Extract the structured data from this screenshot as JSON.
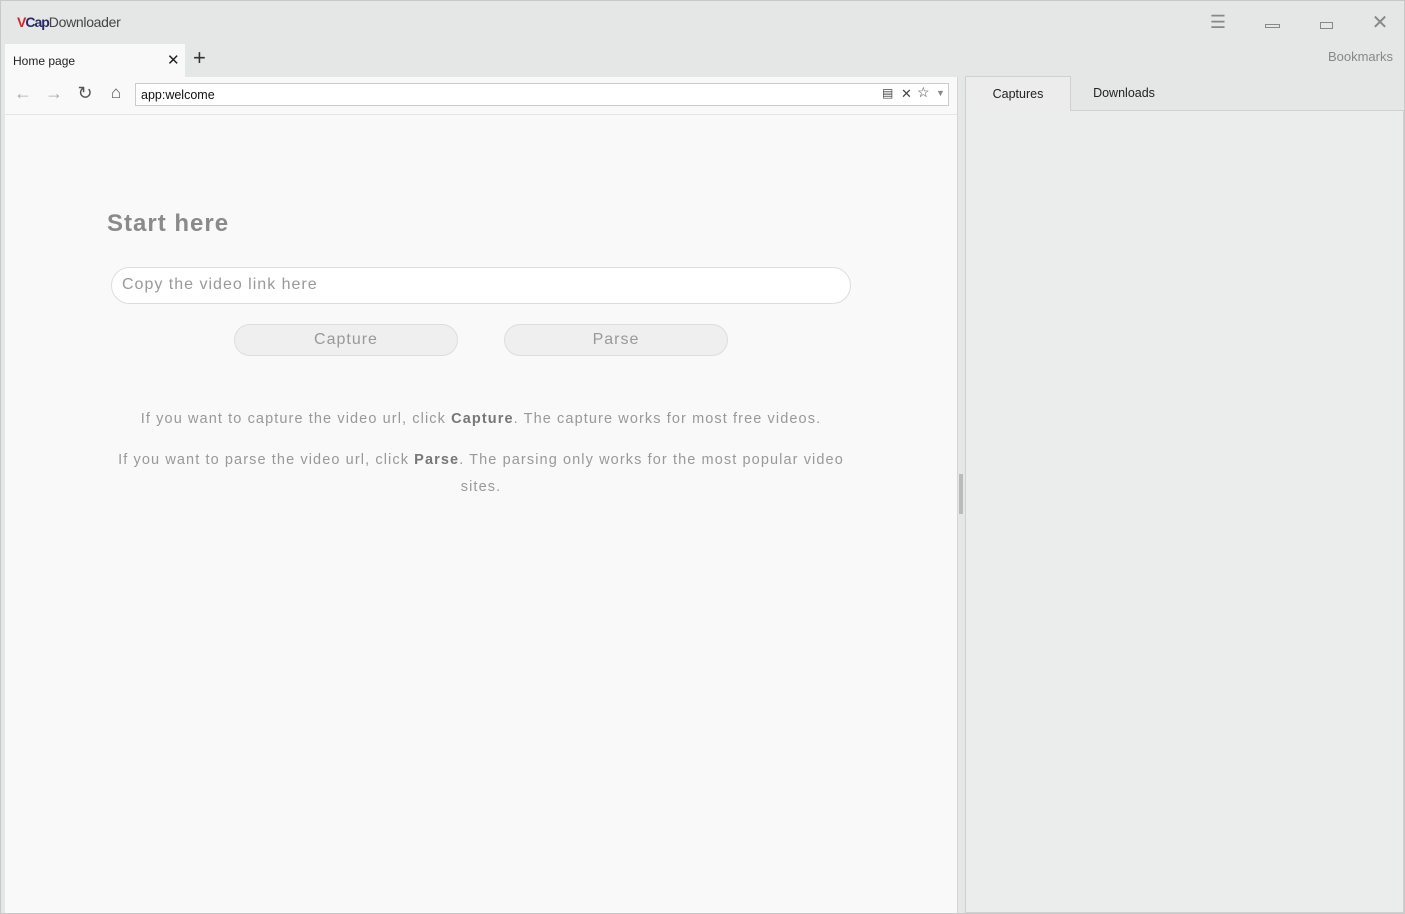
{
  "app": {
    "logo_v": "V",
    "logo_cap": "Cap",
    "title": "Downloader"
  },
  "window": {
    "menu_icon": "☰",
    "minimize_icon": "▬",
    "maximize_icon": "▭",
    "close_icon": "✕",
    "bookmarks": "Bookmarks"
  },
  "tabs": [
    {
      "label": "Home page"
    }
  ],
  "toolbar": {
    "url": "app:welcome"
  },
  "main": {
    "heading": "Start here",
    "input_placeholder": "Copy the video link here",
    "capture_label": "Capture",
    "parse_label": "Parse",
    "p1_pre": "If you want to capture the video url, click ",
    "p1_bold": "Capture",
    "p1_post": ". The capture works for most free videos.",
    "p2_pre": "If you want to parse the video url, click ",
    "p2_bold": "Parse",
    "p2_post": ". The parsing only works for the most popular video sites."
  },
  "side_tabs": [
    {
      "label": "Captures",
      "active": true
    },
    {
      "label": "Downloads",
      "active": false
    }
  ]
}
